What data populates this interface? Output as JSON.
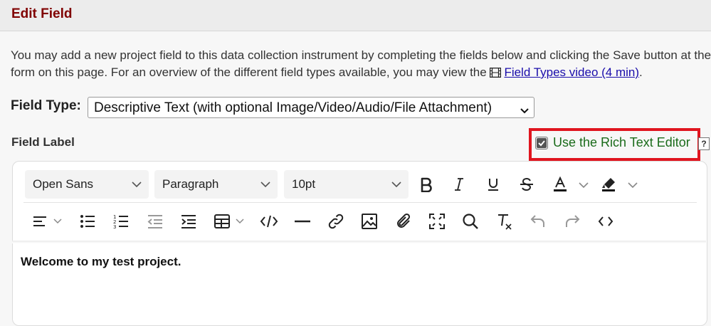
{
  "header": {
    "title": "Edit Field"
  },
  "intro": {
    "line1": "You may add a new project field to this data collection instrument by completing the fields below and clicking the Save button at the bottom of the pop-up",
    "line2_before": "form on this page. For an overview of the different field types available, you may view the ",
    "video_link": "Field Types video (4 min)",
    "line2_after": "."
  },
  "field_type": {
    "label": "Field Type:",
    "selected": "Descriptive Text (with optional Image/Video/Audio/File Attachment)"
  },
  "field_label": {
    "label": "Field Label"
  },
  "rich_text": {
    "label": "Use the Rich Text Editor",
    "checked": true,
    "help": "?"
  },
  "toolbar": {
    "font_family": "Open Sans",
    "block_format": "Paragraph",
    "font_size": "10pt"
  },
  "editor": {
    "content": "Welcome to my test project."
  },
  "colors": {
    "accent": "#800000",
    "highlight_box": "#e0151f",
    "rte_label": "#1a6b1a"
  }
}
